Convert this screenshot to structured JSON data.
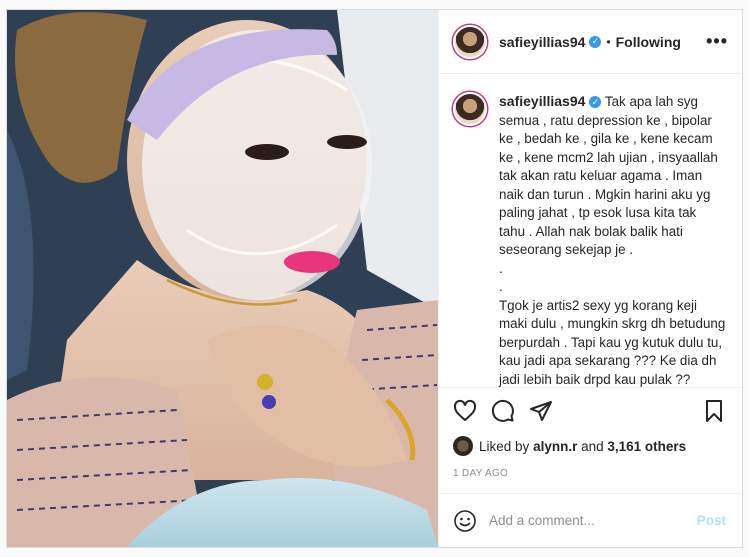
{
  "header": {
    "username": "safieyillias94",
    "separator": "•",
    "follow_status": "Following",
    "more_label": "•••"
  },
  "caption": {
    "username": "safieyillias94",
    "text": "Tak apa lah syg semua , ratu depression ke , bipolar ke , bedah ke , gila ke , kene kecam ke , kene mcm2 lah ujian , insyaallah tak akan ratu keluar agama . Iman naik dan turun . Mgkin harini aku yg paling jahat , tp esok lusa kita tak tahu . Allah nak bolak balik hati seseorang sekejap je .\n.\n.\nTgok je artis2 sexy yg korang keji maki dulu , mungkin skrg dh betudung berpurdah . Tapi kau yg kutuk dulu tu, kau jadi apa sekarang ??? Ke dia dh jadi lebih baik drpd kau pulak ??\n.\n.\nPLEASE RESPECT ORANG YG SEDANG"
  },
  "icons": {
    "like": "heart-icon",
    "comment": "comment-icon",
    "share": "share-icon",
    "save": "bookmark-icon",
    "emoji": "emoji-icon"
  },
  "likes": {
    "prefix": "Liked by",
    "user": "alynn.r",
    "joiner": "and",
    "others": "3,161 others"
  },
  "timestamp": "1 DAY AGO",
  "comment": {
    "placeholder": "Add a comment...",
    "post_label": "Post"
  },
  "colors": {
    "verified": "#3897f0",
    "post_disabled": "#b2dffc",
    "lipstick": "#e8357d"
  }
}
